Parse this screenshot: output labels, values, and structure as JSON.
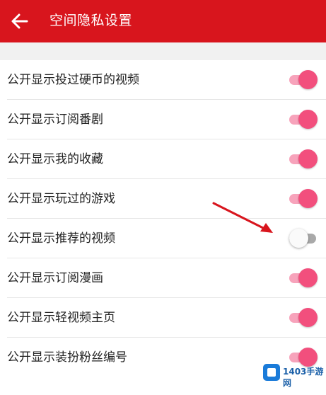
{
  "header": {
    "title": "空间隐私设置",
    "back_icon": "arrow-left-icon"
  },
  "colors": {
    "header_bg": "#d8151d",
    "toggle_on": "#f24f7d",
    "toggle_off": "#a9a9a9"
  },
  "settings": [
    {
      "label": "公开显示投过硬币的视频",
      "enabled": true
    },
    {
      "label": "公开显示订阅番剧",
      "enabled": true
    },
    {
      "label": "公开显示我的收藏",
      "enabled": true
    },
    {
      "label": "公开显示玩过的游戏",
      "enabled": true
    },
    {
      "label": "公开显示推荐的视频",
      "enabled": false
    },
    {
      "label": "公开显示订阅漫画",
      "enabled": true
    },
    {
      "label": "公开显示轻视频主页",
      "enabled": true
    },
    {
      "label": "公开显示装扮粉丝编号",
      "enabled": true
    }
  ],
  "watermark": {
    "text": "1403手游网"
  }
}
